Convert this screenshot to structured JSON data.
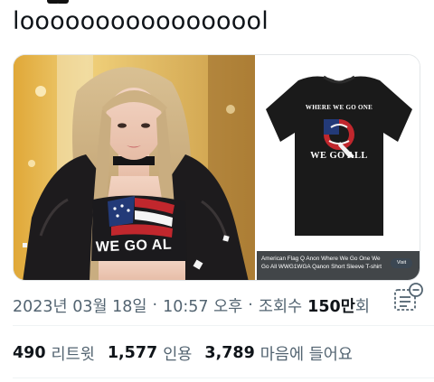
{
  "tweet": {
    "text": "looooooooooooooool"
  },
  "media": {
    "product": {
      "shirt_text_top": "WHERE WE GO ONE",
      "shirt_text_bottom": "WE GO ALL",
      "shirt_letter": "Q",
      "caption": "American Flag Q Anon Where We Go One We Go All WWG1WGA Qanon Short Sleeve T-shirt",
      "visit_label": "Visit"
    },
    "photo": {
      "top_text": "WE GO AL"
    }
  },
  "meta": {
    "date": "2023년 03월 18일",
    "separator": "·",
    "time": "10:57 오후",
    "separator2": "·",
    "views_label": "조회수",
    "views_value": "150만",
    "views_suffix": "회"
  },
  "stats": {
    "retweets_value": "490",
    "retweets_label": "리트윗",
    "quotes_value": "1,577",
    "quotes_label": "인용",
    "likes_value": "3,789",
    "likes_label": "마음에 들어요"
  },
  "icons": {
    "analytics": "analytics-icon"
  },
  "colors": {
    "text_primary": "#0f1419",
    "text_secondary": "#536471",
    "divider": "#eff3f4"
  }
}
